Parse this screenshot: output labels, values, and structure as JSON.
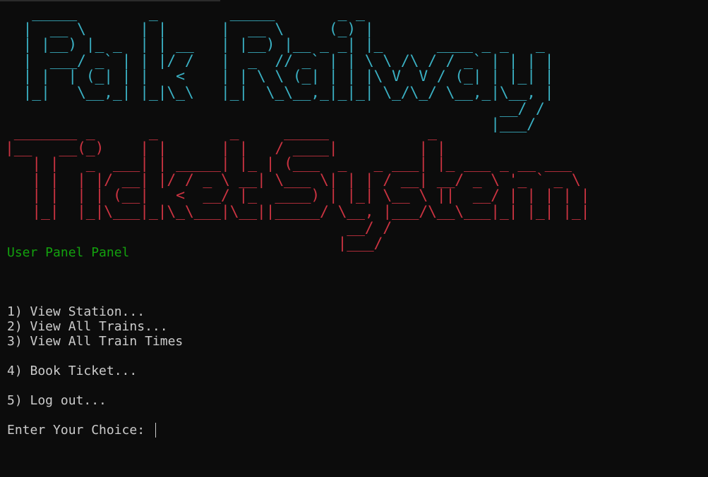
{
  "colors": {
    "background": "#0c0c0c",
    "text": "#cccccc",
    "banner_1": "#3ab0c3",
    "banner_2": "#cb3341",
    "subtitle": "#13a10e"
  },
  "banners": [
    {
      "text": "Pak Railway",
      "art": "   _____        _        _____       _ _\n  |  __ \\      | |      |  __ \\     (_) |\n  | |__) |_ _  | | __   | |__) |__ _ _| |_      ____ _ _   _\n  |  ___/ _` | | |/ /   |  _  // _` | | \\ \\ /\\ / / _` | | | |\n  | |  | (_| | |   <    | | \\ \\ (_| | | |\\ V  V / (_| | |_| |\n  |_|   \\__,_| |_|\\_\\   |_|  \\_\\__,_|_|_| \\_/\\_/ \\__,_|\\__, |\n                                                       __/ /\n                                                      |___/"
    },
    {
      "text": "Ticket System",
      "art": " _______ _      _        _     _____           _\n|__   __(_)    | |      | |   / ____|         | |\n   | |   _  ___| | _____| |_ | (___  _   _ ___| |_ ___ _ __ ___\n   | |  | |/ __| |/ / _ \\ __| \\___ \\| | | / __| __/ _ \\ '_ ` _ \\\n   | |  | | (__|   <  __/ |_  ____) | |_| \\__ \\ ||  __/ | | | | |\n   |_|  |_|\\___|_|\\_\\___|\\__||_____/ \\__, |___/\\__\\___|_| |_| |_|\n                                      __/ /\n                                     |___/"
    }
  ],
  "subtitle": "User Panel Panel",
  "menu": [
    "1) View Station...",
    "2) View All Trains...",
    "3) View All Train Times",
    "4) Book Ticket...",
    "5) Log out..."
  ],
  "prompt": "Enter Your Choice: "
}
